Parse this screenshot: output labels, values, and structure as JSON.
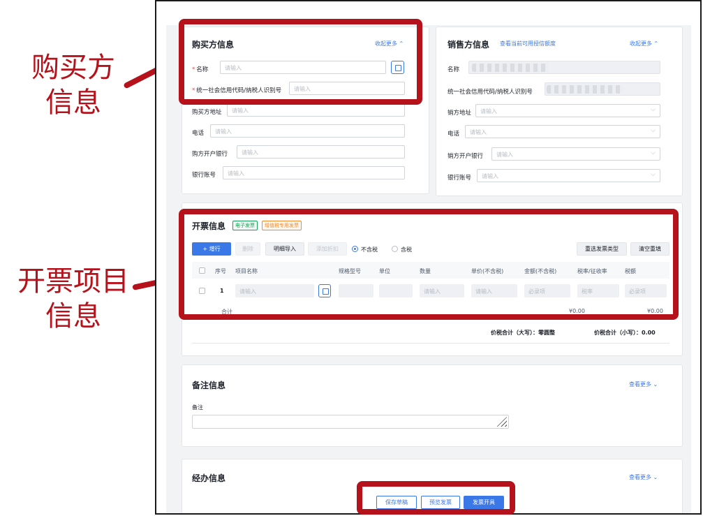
{
  "annotations": {
    "buyer": [
      "购买方",
      "信息"
    ],
    "items": [
      "开票项目",
      "信息"
    ]
  },
  "buyer": {
    "title": "购买方信息",
    "toggle": "收起更多 ⌃",
    "fields": [
      {
        "label": "名称",
        "placeholder": "请输入"
      },
      {
        "label": "统一社会信用代码/纳税人识别号",
        "placeholder": "请输入"
      },
      {
        "label": "购买方地址",
        "placeholder": "请输入"
      },
      {
        "label": "电话",
        "placeholder": "请输入"
      },
      {
        "label": "购方开户银行",
        "placeholder": "请输入"
      },
      {
        "label": "银行账号",
        "placeholder": "请输入"
      }
    ]
  },
  "seller": {
    "title": "销售方信息",
    "quota_link": "查看当前可用授信额度",
    "toggle": "收起更多 ⌃",
    "fields": [
      {
        "label": "名称",
        "placeholder": ""
      },
      {
        "label": "统一社会信用代码/纳税人识别号",
        "placeholder": ""
      },
      {
        "label": "销方地址",
        "placeholder": "请输入"
      },
      {
        "label": "电话",
        "placeholder": "请输入"
      },
      {
        "label": "销方开户银行",
        "placeholder": "请输入"
      },
      {
        "label": "银行账号",
        "placeholder": "请输入"
      }
    ]
  },
  "invoice": {
    "title": "开票信息",
    "tags": [
      "电子发票",
      "增值税专用发票"
    ],
    "toolbar": {
      "add": "+ 增行",
      "delete": "删除",
      "import": "明细导入",
      "discount": "添加折扣",
      "tax_excluded": "不含税",
      "tax_included": "含税",
      "reselect": "重选发票类型",
      "clear": "清空重填"
    },
    "columns": [
      "序号",
      "项目名称",
      "规格型号",
      "单位",
      "数量",
      "单价(不含税)",
      "金额(不含税)",
      "税率/征收率",
      "税额"
    ],
    "row": {
      "index": "1",
      "name_placeholder": "请输入",
      "qty_placeholder": "请输入",
      "price_placeholder": "请输入",
      "amount_placeholder": "必录项",
      "rate_placeholder": "税率",
      "tax_placeholder": "必录项"
    },
    "subtotal_label": "合计",
    "subtotal_amount": "¥0.00",
    "subtotal_tax": "¥0.00",
    "total_upper": "价税合计（大写）：零圆整",
    "total_lower": "价税合计（小写）：0.00"
  },
  "remarks": {
    "title": "备注信息",
    "toggle": "查看更多 ⌄",
    "label": "备注"
  },
  "handler": {
    "title": "经办信息",
    "toggle": "查看更多 ⌄"
  },
  "footer": {
    "save": "保存草稿",
    "preview": "预览发票",
    "issue": "发票开具"
  },
  "colors": {
    "annotation": "#b5121b",
    "accent": "#3b78e7"
  }
}
